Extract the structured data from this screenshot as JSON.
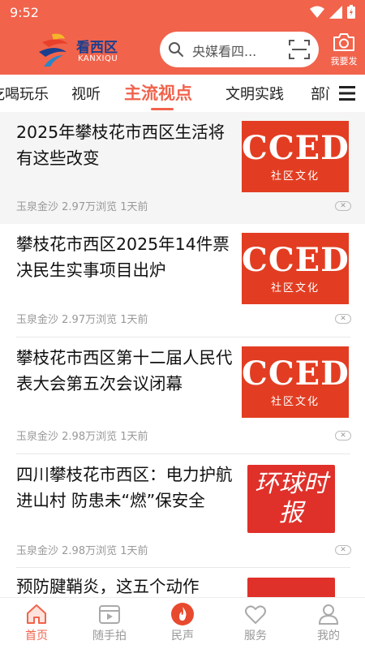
{
  "status": {
    "time": "9:52"
  },
  "header": {
    "logo_title": "看西区",
    "logo_sub": "KANXIQU",
    "search_placeholder": "央媒看四...",
    "camera_label": "我要发"
  },
  "tabs": [
    {
      "label": "吃喝玩乐"
    },
    {
      "label": "视听"
    },
    {
      "label": "主流视点",
      "active": true
    },
    {
      "label": "文明实践"
    },
    {
      "label": "部门"
    }
  ],
  "feed": [
    {
      "title": "2025年攀枝花市西区生活将有这些改变",
      "source": "玉泉金沙",
      "views": "2.97万浏览",
      "time": "1天前",
      "thumb": {
        "big": "CCED",
        "small": "社区文化"
      }
    },
    {
      "title": "攀枝花市西区2025年14件票决民生实事项目出炉",
      "source": "玉泉金沙",
      "views": "2.97万浏览",
      "time": "1天前",
      "thumb": {
        "big": "CCED",
        "small": "社区文化"
      }
    },
    {
      "title": "攀枝花市西区第十二届人民代表大会第五次会议闭幕",
      "source": "玉泉金沙",
      "views": "2.98万浏览",
      "time": "1天前",
      "thumb": {
        "big": "CCED",
        "small": "社区文化"
      }
    },
    {
      "title": "四川攀枝花市西区：电力护航进山村 防患未“燃”保安全",
      "source": "玉泉金沙",
      "views": "2.98万浏览",
      "time": "1天前",
      "thumb": {
        "text": "环球时报"
      }
    },
    {
      "title": "预防腱鞘炎，这五个动作"
    }
  ],
  "close_glyph": "✕",
  "bottom_nav": [
    {
      "label": "首页",
      "icon": "home-icon",
      "active": true
    },
    {
      "label": "随手拍",
      "icon": "video-icon"
    },
    {
      "label": "民声",
      "icon": "flame-icon"
    },
    {
      "label": "服务",
      "icon": "heart-icon"
    },
    {
      "label": "我的",
      "icon": "user-icon"
    }
  ],
  "colors": {
    "accent": "#f1634b",
    "thumb_red": "#e23d22",
    "logo_blue": "#1a3f8f"
  }
}
